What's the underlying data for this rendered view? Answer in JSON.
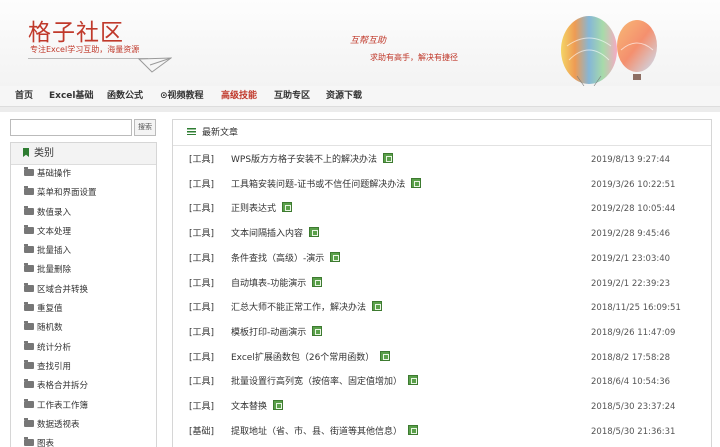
{
  "header": {
    "site_title": "格子社区",
    "site_subtitle": "专注Excel学习互助，海量资源",
    "slogan_main": "互帮互助",
    "slogan_sub": "求助有高手，解决有捷径"
  },
  "nav": {
    "items": [
      {
        "label": "首页",
        "active": false
      },
      {
        "label": "Excel基础",
        "active": false
      },
      {
        "label": "函数公式",
        "active": false
      },
      {
        "label": "⊙视频教程",
        "active": false
      },
      {
        "label": "高级技能",
        "active": true
      },
      {
        "label": "互助专区",
        "active": false
      },
      {
        "label": "资源下载",
        "active": false
      }
    ]
  },
  "search": {
    "placeholder": "",
    "button_label": "搜索"
  },
  "sidebar": {
    "title": "类别",
    "items": [
      {
        "label": "基础操作"
      },
      {
        "label": "菜单和界面设置"
      },
      {
        "label": "数值录入"
      },
      {
        "label": "文本处理"
      },
      {
        "label": "批量插入"
      },
      {
        "label": "批量删除"
      },
      {
        "label": "区域合并转换"
      },
      {
        "label": "重复值"
      },
      {
        "label": "随机数"
      },
      {
        "label": "统计分析"
      },
      {
        "label": "查找引用"
      },
      {
        "label": "表格合并拆分"
      },
      {
        "label": "工作表工作簿"
      },
      {
        "label": "数据透视表"
      },
      {
        "label": "图表"
      }
    ]
  },
  "main": {
    "heading": "最新文章",
    "articles": [
      {
        "category": "[工具]",
        "title": "WPS版方方格子安装不上的解决办法",
        "time": "2019/8/13 9:27:44"
      },
      {
        "category": "[工具]",
        "title": "工具箱安装问题-证书或不信任问题解决办法",
        "time": "2019/3/26 10:22:51"
      },
      {
        "category": "[工具]",
        "title": "正则表达式",
        "time": "2019/2/28 10:05:44"
      },
      {
        "category": "[工具]",
        "title": "文本间隔插入内容",
        "time": "2019/2/28 9:45:46"
      },
      {
        "category": "[工具]",
        "title": "条件查找（高级）-演示",
        "time": "2019/2/1 23:03:40"
      },
      {
        "category": "[工具]",
        "title": "自动填表-功能演示",
        "time": "2019/2/1 22:39:23"
      },
      {
        "category": "[工具]",
        "title": "汇总大师不能正常工作，解决办法",
        "time": "2018/11/25 16:09:51"
      },
      {
        "category": "[工具]",
        "title": "模板打印-动画演示",
        "time": "2018/9/26 11:47:09"
      },
      {
        "category": "[工具]",
        "title": "Excel扩展函数包（26个常用函数）",
        "time": "2018/8/2 17:58:28"
      },
      {
        "category": "[工具]",
        "title": "批量设置行高列宽（按倍率、固定值增加）",
        "time": "2018/6/4 10:54:36"
      },
      {
        "category": "[工具]",
        "title": "文本替换",
        "time": "2018/5/30 23:37:24"
      },
      {
        "category": "[基础]",
        "title": "提取地址（省、市、县、街道等其他信息）",
        "time": "2018/5/30 21:36:31"
      }
    ]
  },
  "colors": {
    "brand_red": "#c0392b",
    "icon_green": "#2e7d32"
  }
}
